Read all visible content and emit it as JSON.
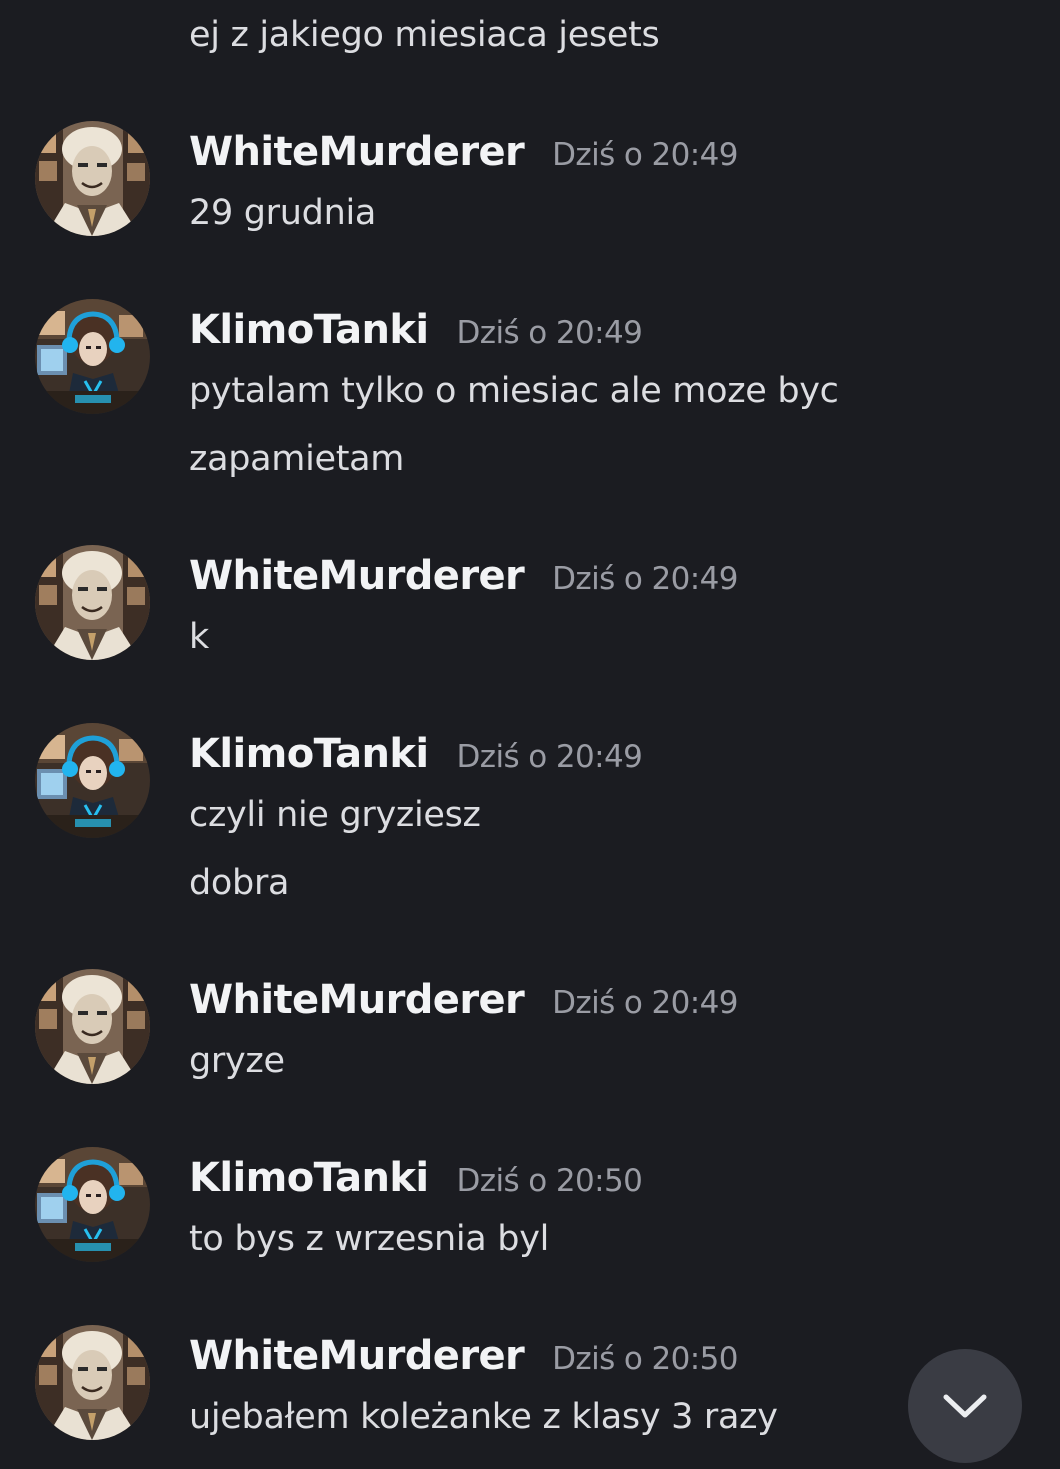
{
  "messages": [
    {
      "id": "prev",
      "lines": [
        "ej z jakiego miesiaca jesets"
      ]
    },
    {
      "id": "m1",
      "author": "WhiteMurderer",
      "avatar_icon": "white-murderer-avatar",
      "timestamp": "Dziś o 20:49",
      "lines": [
        "29 grudnia"
      ]
    },
    {
      "id": "m2",
      "author": "KlimoTanki",
      "avatar_icon": "klimotanki-avatar",
      "timestamp": "Dziś o 20:49",
      "lines": [
        "pytalam tylko o miesiac ale moze byc",
        "zapamietam"
      ]
    },
    {
      "id": "m3",
      "author": "WhiteMurderer",
      "avatar_icon": "white-murderer-avatar",
      "timestamp": "Dziś o 20:49",
      "lines": [
        "k"
      ]
    },
    {
      "id": "m4",
      "author": "KlimoTanki",
      "avatar_icon": "klimotanki-avatar",
      "timestamp": "Dziś o 20:49",
      "lines": [
        "czyli nie gryziesz",
        "dobra"
      ]
    },
    {
      "id": "m5",
      "author": "WhiteMurderer",
      "avatar_icon": "white-murderer-avatar",
      "timestamp": "Dziś o 20:49",
      "lines": [
        "gryze"
      ]
    },
    {
      "id": "m6",
      "author": "KlimoTanki",
      "avatar_icon": "klimotanki-avatar",
      "timestamp": "Dziś o 20:50",
      "lines": [
        "to bys z wrzesnia byl"
      ]
    },
    {
      "id": "m7",
      "author": "WhiteMurderer",
      "avatar_icon": "white-murderer-avatar",
      "timestamp": "Dziś o 20:50",
      "lines": [
        "ujebałem koleżanke z klasy 3 razy"
      ]
    }
  ],
  "jump_button": {
    "icon": "chevron-down-icon"
  },
  "colors": {
    "background": "#1b1c21",
    "username": "#f2f3f5",
    "message_text": "#dcdde1",
    "timestamp": "#9a9ca4",
    "jump_button": "#3a3c44"
  }
}
